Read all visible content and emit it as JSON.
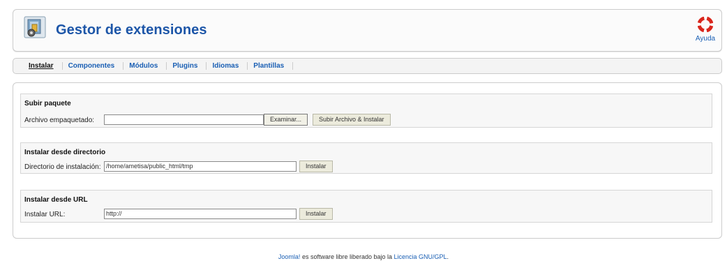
{
  "header": {
    "title": "Gestor de extensiones",
    "icon": "extension-manager-icon",
    "help_label": "Ayuda",
    "help_icon": "lifebuoy-icon"
  },
  "tabs": [
    {
      "label": "Instalar",
      "active": true
    },
    {
      "label": "Componentes"
    },
    {
      "label": "Módulos"
    },
    {
      "label": "Plugins"
    },
    {
      "label": "Idiomas"
    },
    {
      "label": "Plantillas"
    }
  ],
  "upload": {
    "title": "Subir paquete",
    "field_label": "Archivo empaquetado:",
    "value": "",
    "browse_label": "Examinar...",
    "submit_label": "Subir Archivo & Instalar"
  },
  "directory": {
    "title": "Instalar desde directorio",
    "field_label": "Directorio de instalación:",
    "value": "/home/ametisa/public_html/tmp",
    "button_label": "Instalar"
  },
  "url": {
    "title": "Instalar desde URL",
    "field_label": "Instalar URL:",
    "value": "http://",
    "button_label": "Instalar"
  },
  "footer": {
    "link1": "Joomla!",
    "text": " es software libre liberado bajo la ",
    "link2": "Licencia GNU/GPL",
    "end": "."
  },
  "colors": {
    "title_blue": "#1d56a8",
    "link_blue": "#1a5fb4",
    "help_red": "#d9261c"
  }
}
